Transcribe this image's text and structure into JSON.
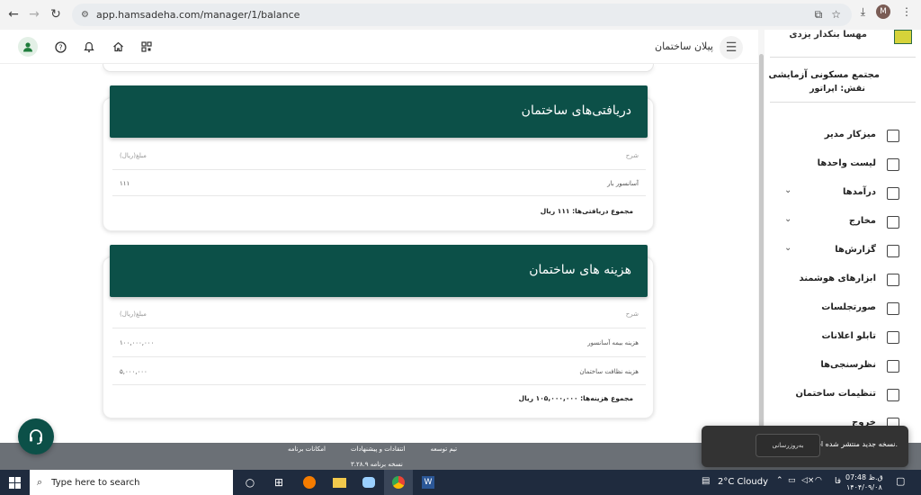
{
  "browser": {
    "url": "app.hamsadeha.com/manager/1/balance",
    "profile_initial": "M"
  },
  "header": {
    "title": "پیلان ساختمان"
  },
  "cards": {
    "receipts": {
      "title": "دریافتی‌های ساختمان",
      "col_desc": "شرح",
      "col_amount": "مبلغ(ریال)",
      "rows": [
        {
          "desc": "آسانسور بار",
          "amount": "۱۱۱"
        }
      ],
      "total": "مجموع دریافتی‌ها: ۱۱۱ ریال"
    },
    "expenses": {
      "title": "هزینه های ساختمان",
      "col_desc": "شرح",
      "col_amount": "مبلغ(ریال)",
      "rows": [
        {
          "desc": "هزینه بیمه آسانسور",
          "amount": "۱۰۰,۰۰۰,۰۰۰"
        },
        {
          "desc": "هزینه نظافت ساختمان",
          "amount": "۵,۰۰۰,۰۰۰"
        }
      ],
      "total": "مجموع هزینه‌ها: ۱۰۵,۰۰۰,۰۰۰ ریال"
    }
  },
  "sidebar": {
    "user_name": "مهسا بنکدار یزدی",
    "complex": "مجتمع مسکونی آزمایشی",
    "role": "نقش: اپراتور",
    "items": [
      {
        "label": "میزکار مدیر",
        "icon": "dashboard-icon",
        "expandable": false
      },
      {
        "label": "لیست واحدها",
        "icon": "building-icon",
        "expandable": false
      },
      {
        "label": "درآمدها",
        "icon": "income-icon",
        "expandable": true
      },
      {
        "label": "مخارج",
        "icon": "card-icon",
        "expandable": true
      },
      {
        "label": "گزارش‌ها",
        "icon": "clipboard-icon",
        "expandable": true
      },
      {
        "label": "ابزارهای هوشمند",
        "icon": "robot-icon",
        "expandable": false
      },
      {
        "label": "صورتجلسات",
        "icon": "document-icon",
        "expandable": false
      },
      {
        "label": "تابلو اعلانات",
        "icon": "board-icon",
        "expandable": false
      },
      {
        "label": "نظرسنجی‌ها",
        "icon": "chart-icon",
        "expandable": false
      },
      {
        "label": "تنظیمات ساختمان",
        "icon": "settings-list-icon",
        "expandable": false
      },
      {
        "label": "خروج",
        "icon": "logout-icon",
        "expandable": false
      }
    ]
  },
  "footer": {
    "links": [
      "امکانات برنامه",
      "انتقادات و پیشنهادات",
      "تیم توسعه"
    ],
    "version": "نسخه برنامه ۳.۲۸.۹"
  },
  "toast": {
    "message": "نسخه جدید منتشر شده است.",
    "button": "به‌روزرسانی"
  },
  "taskbar": {
    "search_placeholder": "Type here to search",
    "weather": "2°C  Cloudy",
    "lang": "فا",
    "time": "07:48 ق.ظ",
    "date": "۱۴۰۴/۰۹/۰۸"
  }
}
